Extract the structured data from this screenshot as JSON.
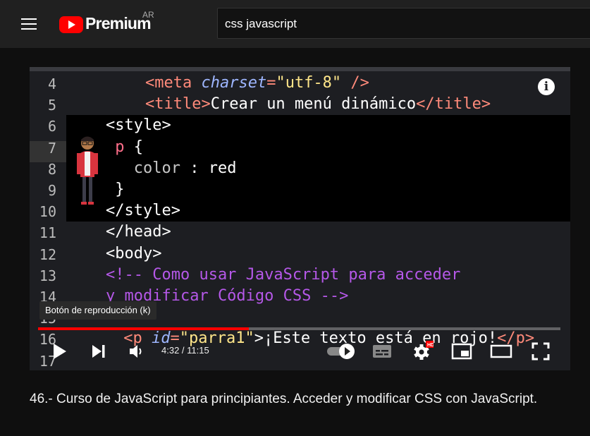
{
  "header": {
    "brand": "Premium",
    "country_code": "AR",
    "search_value": "css javascript"
  },
  "player": {
    "code_lines": [
      {
        "no": "4",
        "parts": [
          {
            "t": "<meta ",
            "c": "tag"
          },
          {
            "t": "charset",
            "c": "attr"
          },
          {
            "t": "=",
            "c": "tag"
          },
          {
            "t": "\"utf-8\"",
            "c": "str"
          },
          {
            "t": " />",
            "c": "tag"
          }
        ]
      },
      {
        "no": "5",
        "parts": [
          {
            "t": "<title>",
            "c": "tag"
          },
          {
            "t": "Crear un menú dinámico",
            "c": "plain"
          },
          {
            "t": "</title>",
            "c": "tag"
          }
        ]
      },
      {
        "no": "6",
        "parts": [
          {
            "t": "<style>",
            "c": "plain"
          }
        ]
      },
      {
        "no": "7",
        "parts": [
          {
            "t": " p ",
            "c": "kw"
          },
          {
            "t": "{",
            "c": "plain"
          }
        ]
      },
      {
        "no": "8",
        "parts": [
          {
            "t": "   color",
            "c": "grey"
          },
          {
            "t": " : red",
            "c": "plain"
          }
        ]
      },
      {
        "no": "9",
        "parts": [
          {
            "t": " }",
            "c": "plain"
          }
        ]
      },
      {
        "no": "10",
        "parts": [
          {
            "t": "</style>",
            "c": "plain"
          }
        ]
      },
      {
        "no": "11",
        "parts": [
          {
            "t": "</head>",
            "c": "plain"
          }
        ]
      },
      {
        "no": "12",
        "parts": [
          {
            "t": "<body>",
            "c": "plain"
          }
        ]
      },
      {
        "no": "13",
        "parts": [
          {
            "t": "<!-- Como usar JavaScript para acceder",
            "c": "comment"
          }
        ]
      },
      {
        "no": "14",
        "parts": [
          {
            "t": "y modificar Código CSS -->",
            "c": "comment"
          }
        ]
      },
      {
        "no": "15",
        "parts": []
      },
      {
        "no": "16",
        "parts": [
          {
            "t": " <p ",
            "c": "tag"
          },
          {
            "t": "id",
            "c": "attr"
          },
          {
            "t": "=",
            "c": "tag"
          },
          {
            "t": "\"parra1\"",
            "c": "str"
          },
          {
            "t": ">¡Este texto está en rojo!",
            "c": "plain"
          },
          {
            "t": "</p>",
            "c": "tag"
          }
        ]
      },
      {
        "no": "17",
        "parts": []
      }
    ],
    "info_label": "i",
    "tooltip": "Botón de reproducción (k)",
    "current_time": "4:32",
    "duration": "11:15",
    "time_display": "4:32 / 11:15",
    "progress_fraction": 0.403,
    "hd_badge": "HD",
    "colors": {
      "progress": "#ff0000",
      "brand_red": "#ff0000"
    },
    "icons": [
      "play-icon",
      "next-icon",
      "volume-icon",
      "autoplay-toggle-icon",
      "subtitles-icon",
      "settings-icon",
      "miniplayer-icon",
      "theater-mode-icon",
      "fullscreen-icon"
    ]
  },
  "video": {
    "title": "46.- Curso de JavaScript para principiantes. Acceder y modificar CSS con JavaScript."
  }
}
